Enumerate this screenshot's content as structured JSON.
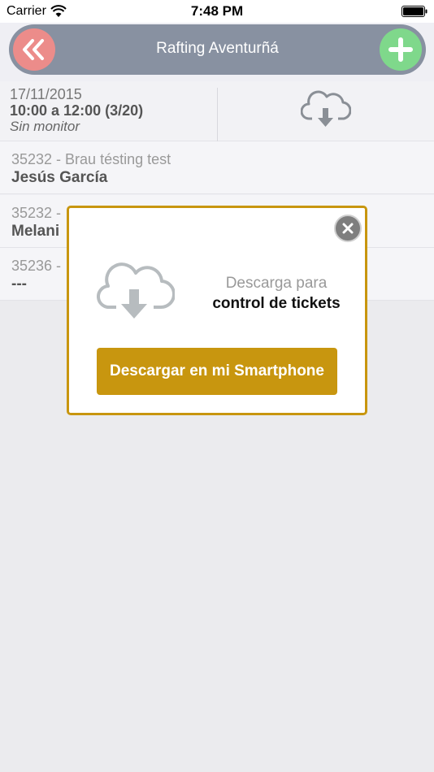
{
  "status_bar": {
    "carrier": "Carrier",
    "time": "7:48 PM",
    "icons": [
      "wifi-icon",
      "battery-icon"
    ]
  },
  "nav": {
    "title": "Rafting Aventurñá",
    "back_icon": "double-chevron-left-icon",
    "add_icon": "plus-icon",
    "back_color": "#ec8c8a",
    "add_color": "#7fd88b",
    "bar_color": "#8891a1"
  },
  "session": {
    "date": "17/11/2015",
    "time_range": "10:00 a 12:00 (3/20)",
    "monitor": "Sin monitor",
    "download_icon": "cloud-download-icon"
  },
  "bookings": [
    {
      "id_text": "35232 - Brau tésting test",
      "name": "Jesús García"
    },
    {
      "id_text": "35232 -",
      "name": "Melani"
    },
    {
      "id_text": "35236 -",
      "name": "---"
    }
  ],
  "modal": {
    "line1": "Descarga para",
    "line2": "control de tickets",
    "button_label": "Descargar en mi Smartphone",
    "close_icon": "close-icon",
    "accent_color": "#c8960f"
  }
}
